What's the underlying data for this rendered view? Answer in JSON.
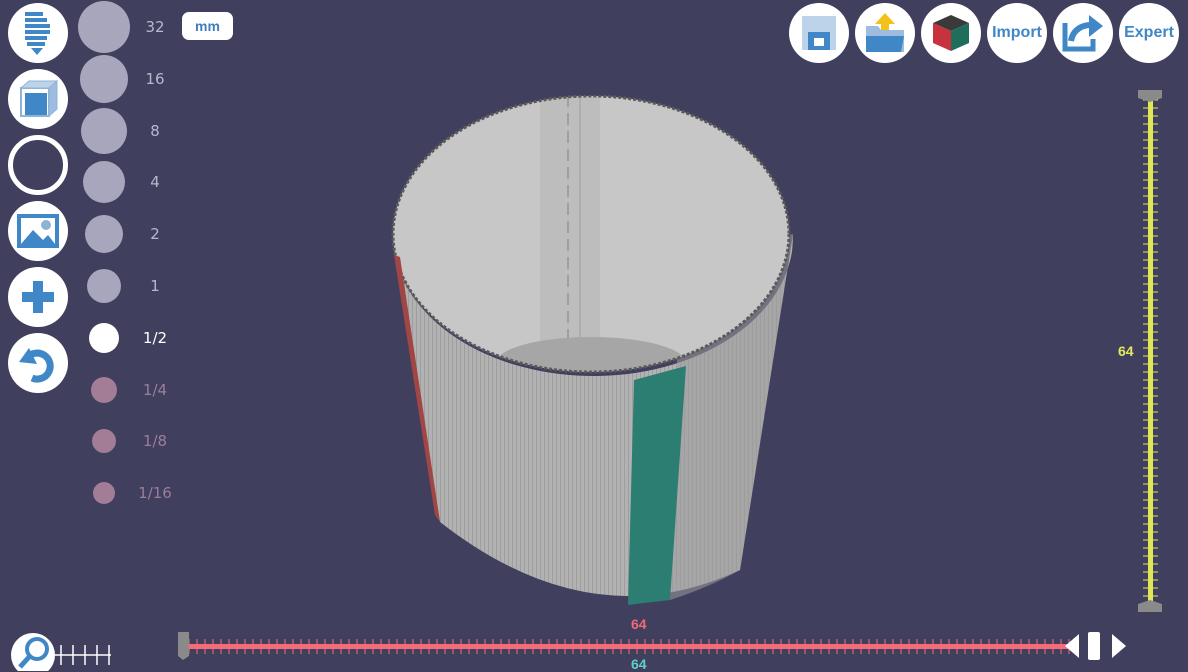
{
  "left_toolbar": {
    "buttons": [
      {
        "name": "layers-tool-button",
        "icon": "stacked-layers-icon"
      },
      {
        "name": "cube-tool-button",
        "icon": "cube-icon"
      },
      {
        "name": "ring-tool-button",
        "icon": "ring-icon"
      },
      {
        "name": "image-tool-button",
        "icon": "image-icon"
      },
      {
        "name": "add-button",
        "icon": "plus-icon"
      },
      {
        "name": "undo-button",
        "icon": "undo-icon"
      }
    ]
  },
  "sizes": {
    "items": [
      {
        "label": "32",
        "state": "available"
      },
      {
        "label": "16",
        "state": "available"
      },
      {
        "label": "8",
        "state": "available"
      },
      {
        "label": "4",
        "state": "available"
      },
      {
        "label": "2",
        "state": "available"
      },
      {
        "label": "1",
        "state": "available"
      },
      {
        "label": "1/2",
        "state": "selected"
      },
      {
        "label": "1/4",
        "state": "disabled"
      },
      {
        "label": "1/8",
        "state": "disabled"
      },
      {
        "label": "1/16",
        "state": "disabled"
      }
    ]
  },
  "unit_toggle": {
    "label": "mm"
  },
  "top_toolbar": {
    "save_icon": "save-icon",
    "open_icon": "open-folder-icon",
    "color_cube_icon": "color-cube-icon",
    "import_label": "Import",
    "export_icon": "share-export-icon",
    "expert_label": "Expert"
  },
  "y_axis": {
    "value": "64",
    "color": "#e4ea5a"
  },
  "x_axis": {
    "value": "64",
    "color": "#f06a78"
  },
  "z_axis": {
    "value": "64",
    "color": "#5fd0c8"
  },
  "colors": {
    "background": "#403f5e",
    "accent_blue": "#3f87c6",
    "slider_red": "#f56b78",
    "slider_yellow": "#e0e85a",
    "model_gray": "#aaaaaa",
    "model_teal": "#2c7d72",
    "model_red": "#a24545"
  }
}
